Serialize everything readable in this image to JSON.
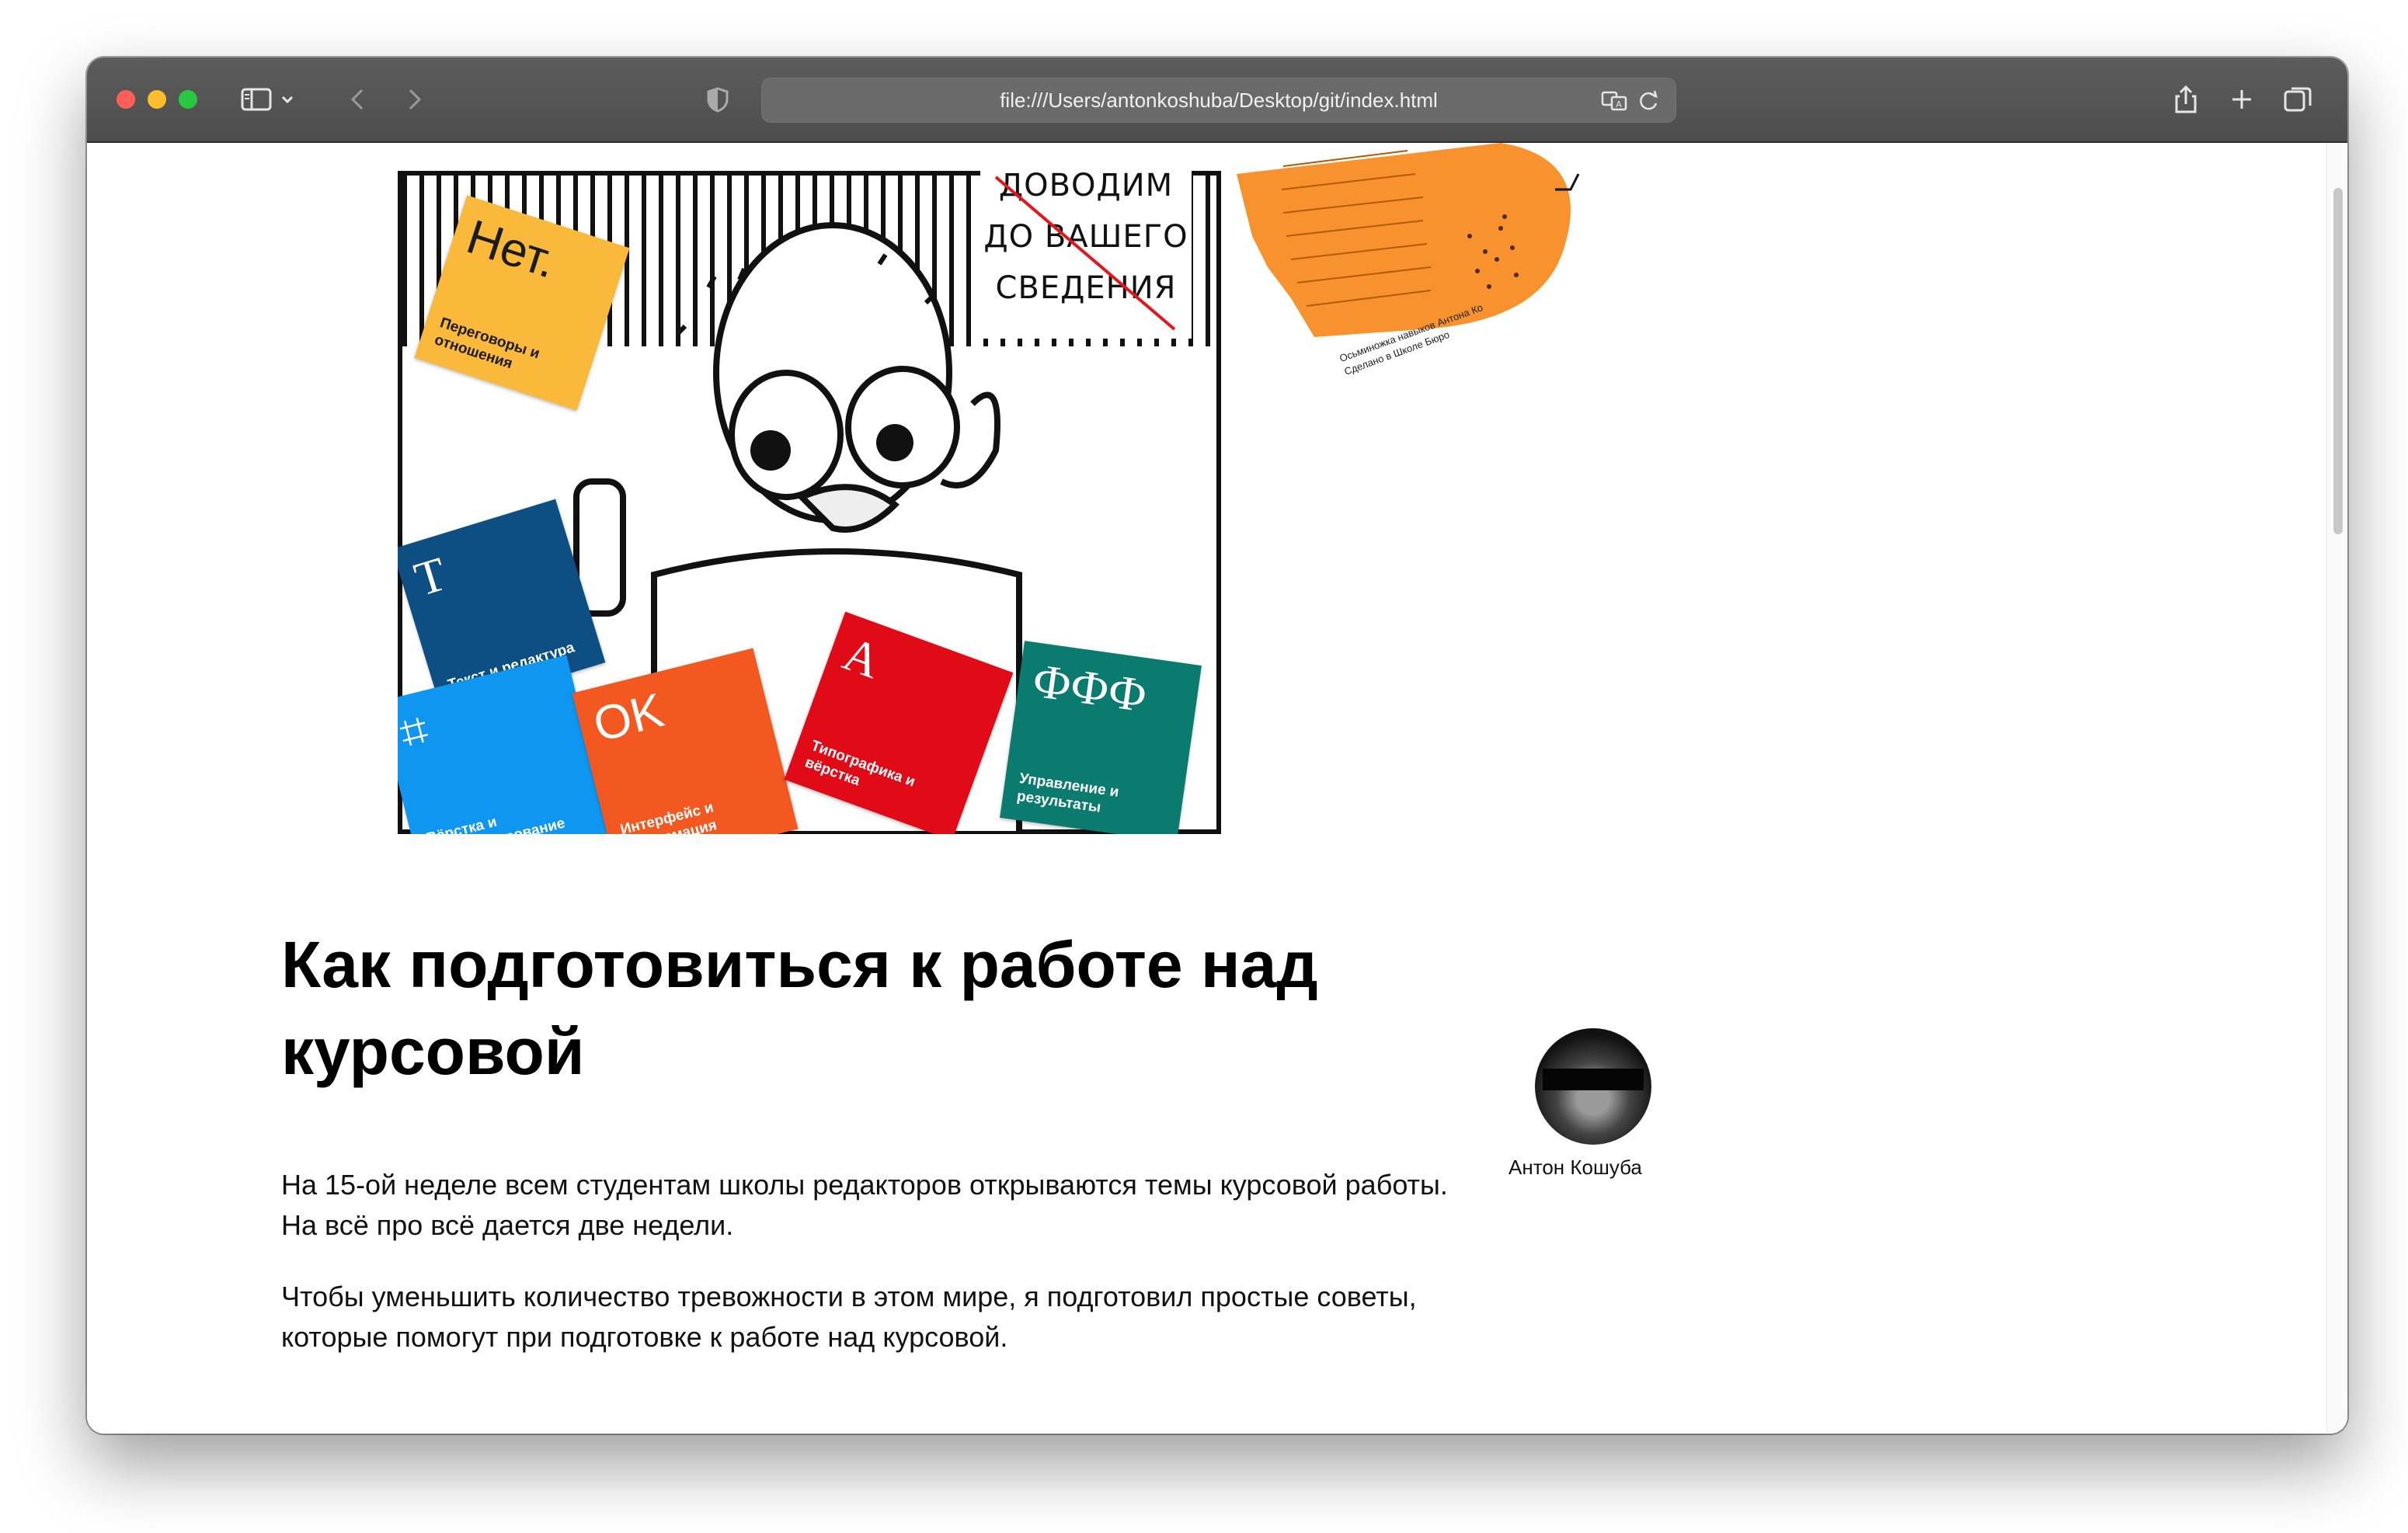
{
  "browser": {
    "url": "file:///Users/antonkoshuba/Desktop/git/index.html"
  },
  "hero": {
    "cards": [
      {
        "big": "Нет.",
        "caption": "Переговоры и отношения",
        "color": "#fbb93b"
      },
      {
        "big": "T",
        "caption": "Текст и редактура",
        "color": "#0d4f83"
      },
      {
        "big": "⌗",
        "caption": "Вёрстка и прототипирование",
        "color": "#0f96f0"
      },
      {
        "big": "OK",
        "caption": "Интерфейс и информация",
        "color": "#f35821"
      },
      {
        "big": "A",
        "caption": "Типографика и вёрстка",
        "color": "#e10b17"
      },
      {
        "big": "ФФФ",
        "caption": "Управление и результаты",
        "color": "#0b7a6f"
      }
    ],
    "notice_lines": [
      "ДОВОДИМ",
      "ДО ВАШЕГО",
      "СВЕДЕНИЯ"
    ],
    "octopus_caption_1": "Осьминожка навыков Антона Ко",
    "octopus_caption_2": "Сделано в Школе Бюро"
  },
  "article": {
    "title": "Как подготовиться к работе над курсовой",
    "paragraph_1": "На 15-ой неделе всем студентам школы редакторов открываются темы курсовой работы. На всё про всё дается две недели.",
    "paragraph_2": "Чтобы уменьшить количество тревожности в этом мире, я подготовил простые советы, которые помогут при подготовке к работе над курсовой."
  },
  "author": {
    "name": "Антон Кошуба"
  }
}
